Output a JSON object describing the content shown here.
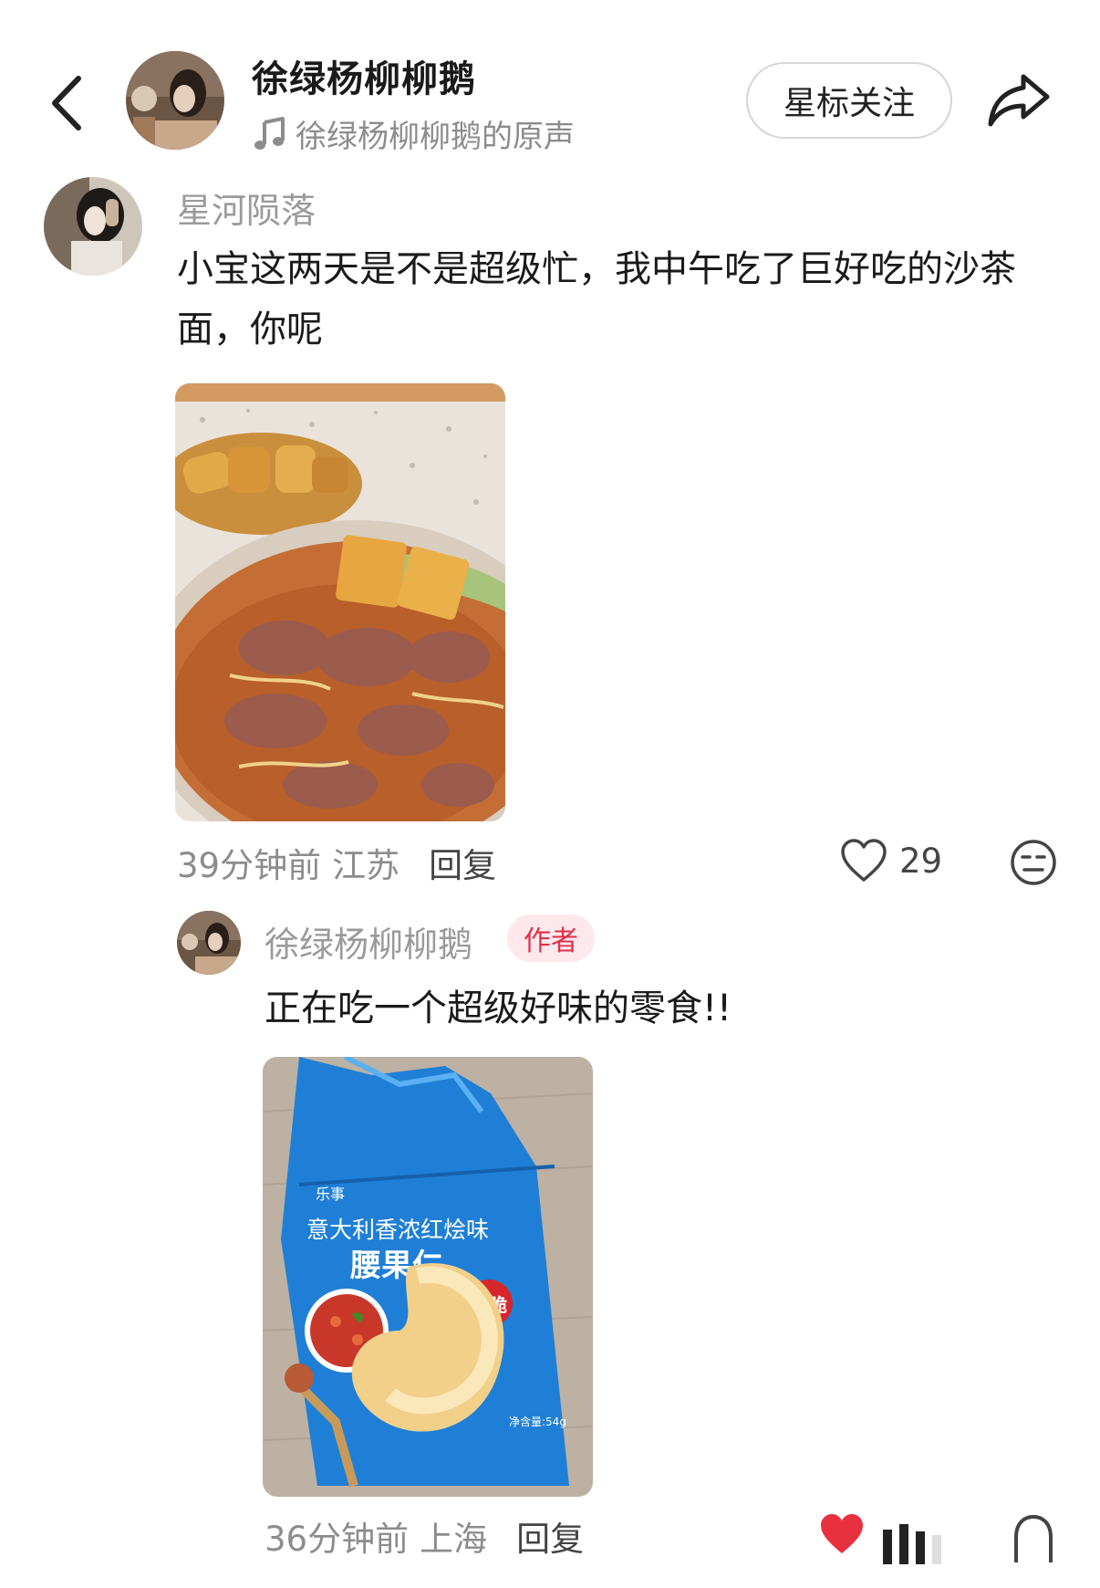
{
  "header": {
    "title": "徐绿杨柳柳鹅",
    "sound": "徐绿杨柳柳鹅的原声",
    "follow_label": "星标关注",
    "back_icon": "chevron-left-icon",
    "share_icon": "share-arrow-icon",
    "music_icon": "music-note-icon"
  },
  "comment": {
    "author": "星河陨落",
    "text": "小宝这两天是不是超级忙，我中午吃了巨好吃的沙茶面，你呢",
    "time": "39分钟前",
    "location": "江苏",
    "reply_label": "回复",
    "likes": "29",
    "like_icon": "heart-outline-icon",
    "dislike_icon": "meh-face-icon"
  },
  "reply": {
    "author": "徐绿杨柳柳鹅",
    "badge": "作者",
    "text": "正在吃一个超级好味的零食!!",
    "time": "36分钟前",
    "location": "上海",
    "reply_label": "回复",
    "like_icon": "heart-filled-icon",
    "accent": "#e8303f"
  },
  "snack_pack": {
    "brand": "乐事",
    "flavor": "意大利香浓红烩味",
    "name": "腰果仁",
    "tag": "爆脆",
    "weight": "净含量:54g"
  }
}
